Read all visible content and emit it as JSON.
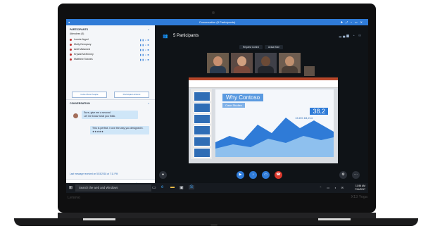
{
  "window": {
    "title": "Conversation (5 Participants)",
    "controls": [
      "✚",
      "⤢",
      "⎯",
      "▭",
      "✕"
    ]
  },
  "participants_panel": {
    "header": "PARTICIPANTS",
    "attendees_label": "Attendees (5)",
    "people": [
      {
        "name": "Lonnie Appel"
      },
      {
        "name": "Molly Dempsey"
      },
      {
        "name": "Amit Malamed"
      },
      {
        "name": "Krystal McKinney"
      },
      {
        "name": "Matthew Townes"
      }
    ],
    "buttons": [
      "Invite More People",
      "Participant Actions"
    ]
  },
  "conversation": {
    "header": "CONVERSATION",
    "messages": [
      {
        "text": "Sure, give me a second"
      },
      {
        "text": "Let me know what you think."
      },
      {
        "text": "This is perfect. I love the way you designed it. ★★★★★"
      }
    ],
    "last_message": "Last message received on 5/15/2018 at 7:11 PM"
  },
  "video": {
    "participants_title": "5 Participants",
    "request_control": "Request Control",
    "actual_size": "Actual Size",
    "slide_title": "Why Contoso",
    "slide_subtitle": "Case Studies",
    "slide_stat": "38.2",
    "slide_stat2": "15.6% 63,214"
  },
  "taskbar": {
    "search_placeholder": "Search the web and Windows",
    "time": "11:56 AM",
    "date": "7/14/2017"
  },
  "device": {
    "brand": "Lenovo",
    "model": "X13 Yoga"
  },
  "colors": {
    "accent": "#2f7bd7",
    "hangup": "#d9372b"
  }
}
